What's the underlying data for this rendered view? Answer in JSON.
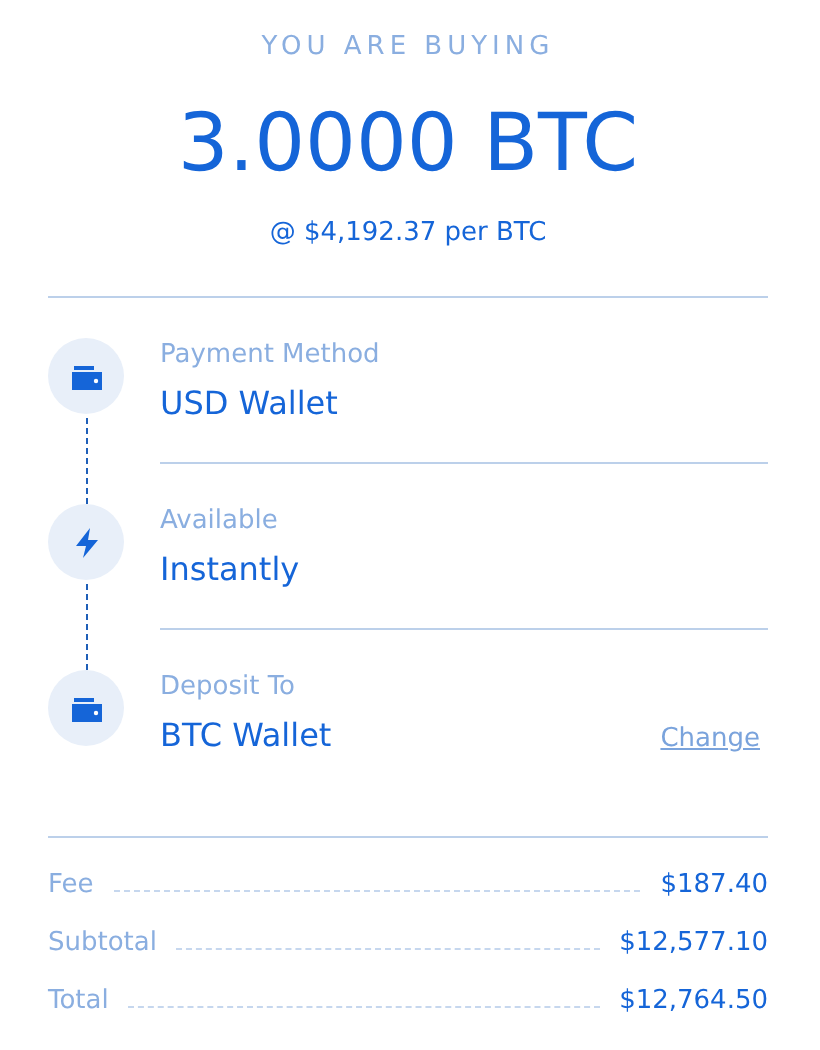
{
  "heading": "YOU ARE BUYING",
  "amount": "3.0000 BTC",
  "rate": "@ $4,192.37 per BTC",
  "steps": [
    {
      "kind": "wallet",
      "label": "Payment Method",
      "value": "USD Wallet"
    },
    {
      "kind": "bolt",
      "label": "Available",
      "value": "Instantly"
    },
    {
      "kind": "wallet",
      "label": "Deposit To",
      "value": "BTC Wallet",
      "action": "Change"
    }
  ],
  "summary": [
    {
      "label": "Fee",
      "value": "$187.40"
    },
    {
      "label": "Subtotal",
      "value": "$12,577.10"
    },
    {
      "label": "Total",
      "value": "$12,764.50"
    }
  ]
}
